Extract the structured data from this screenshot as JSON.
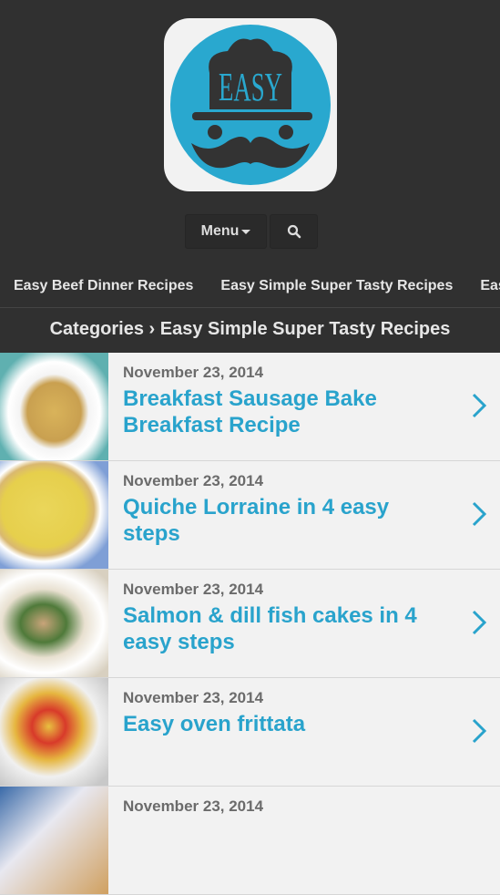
{
  "logo": {
    "text": "EASY",
    "colors": {
      "circle": "#29a8cf",
      "dark": "#333333",
      "bg": "#f2f2f2"
    }
  },
  "nav": {
    "menu_label": "Menu",
    "search_icon": "search-icon"
  },
  "categories": [
    "Easy Beef Dinner Recipes",
    "Easy Simple Super Tasty Recipes",
    "Easy"
  ],
  "breadcrumb": "Categories › Easy Simple Super Tasty Recipes",
  "colors": {
    "accent": "#29a3cc",
    "header": "#303030"
  },
  "posts": [
    {
      "date": "November 23, 2014",
      "title": "Breakfast Sausage Bake Breakfast Recipe"
    },
    {
      "date": "November 23, 2014",
      "title": "Quiche Lorraine in 4 easy steps"
    },
    {
      "date": "November 23, 2014",
      "title": "Salmon & dill fish cakes in 4 easy steps"
    },
    {
      "date": "November 23, 2014",
      "title": "Easy oven frittata"
    },
    {
      "date": "November 23, 2014",
      "title": ""
    }
  ]
}
